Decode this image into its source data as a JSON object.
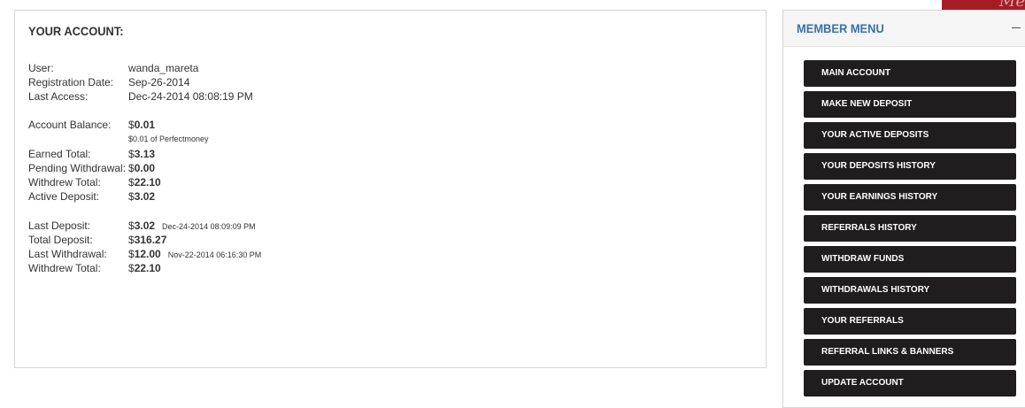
{
  "logo": {
    "text": "Me"
  },
  "account": {
    "title": "YOUR ACCOUNT:",
    "user": {
      "label": "User:",
      "value": "wanda_mareta"
    },
    "registration": {
      "label": "Registration Date:",
      "value": "Sep-26-2014"
    },
    "last_access": {
      "label": "Last Access:",
      "value": "Dec-24-2014 08:08:19 PM"
    },
    "balance": {
      "label": "Account Balance:",
      "currency": "$",
      "value": "0.01",
      "note": "$0.01 of Perfectmoney"
    },
    "earned_total": {
      "label": "Earned Total:",
      "currency": "$",
      "value": "3.13"
    },
    "pending_withdrawal": {
      "label": "Pending Withdrawal:",
      "currency": "$",
      "value": "0.00"
    },
    "withdrew_total": {
      "label": "Withdrew Total:",
      "currency": "$",
      "value": "22.10"
    },
    "active_deposit": {
      "label": "Active Deposit:",
      "currency": "$",
      "value": "3.02"
    },
    "last_deposit": {
      "label": "Last Deposit:",
      "currency": "$",
      "value": "3.02",
      "date": "Dec-24-2014 08:09:09 PM"
    },
    "total_deposit": {
      "label": "Total Deposit:",
      "currency": "$",
      "value": "316.27"
    },
    "last_withdrawal": {
      "label": "Last Withdrawal:",
      "currency": "$",
      "value": "12.00",
      "date": "Nov-22-2014 06:16:30 PM"
    },
    "withdrew_total_2": {
      "label": "Withdrew Total:",
      "currency": "$",
      "value": "22.10"
    }
  },
  "member_menu": {
    "title": "MEMBER MENU",
    "collapse_icon": "minus-icon",
    "items": [
      "MAIN ACCOUNT",
      "MAKE NEW DEPOSIT",
      "YOUR ACTIVE DEPOSITS",
      "YOUR DEPOSITS HISTORY",
      "YOUR EARNINGS HISTORY",
      "REFERRALS HISTORY",
      "WITHDRAW FUNDS",
      "WITHDRAWALS HISTORY",
      "YOUR REFERRALS",
      "REFERRAL LINKS & BANNERS",
      "UPDATE ACCOUNT"
    ]
  }
}
